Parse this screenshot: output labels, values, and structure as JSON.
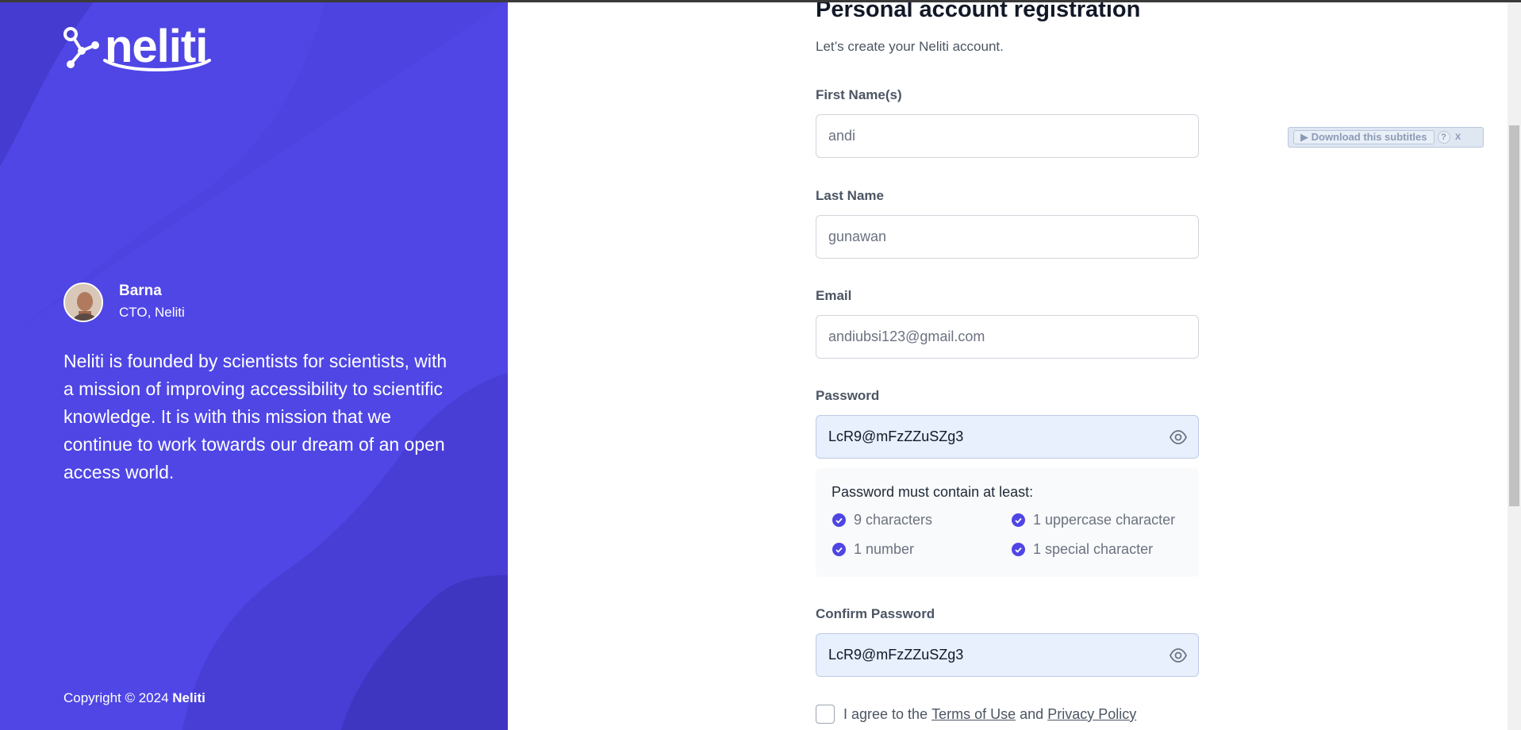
{
  "brand": {
    "name": "neliti",
    "accent_color": "#4f46e5"
  },
  "testimonial": {
    "name": "Barna",
    "role": "CTO, Neliti",
    "quote": "Neliti is founded by scientists for scientists, with a mission of improving accessibility to scientific knowledge. It is with this mission that we continue to work towards our dream of an open access world."
  },
  "footer": {
    "copyright_prefix": "Copyright © 2024",
    "copyright_brand": "Neliti"
  },
  "form": {
    "title": "Personal account registration",
    "subtitle": "Let’s create your Neliti account.",
    "first_name": {
      "label": "First Name(s)",
      "value": "andi"
    },
    "last_name": {
      "label": "Last Name",
      "value": "gunawan"
    },
    "email": {
      "label": "Email",
      "value": "andiubsi123@gmail.com"
    },
    "password": {
      "label": "Password",
      "value": "LcR9@mFzZZuSZg3",
      "icon": "eye-icon"
    },
    "password_requirements": {
      "title": "Password must contain at least:",
      "items": [
        "9 characters",
        "1 uppercase character",
        "1 number",
        "1 special character"
      ]
    },
    "confirm_password": {
      "label": "Confirm Password",
      "value": "LcR9@mFzZZuSZg3",
      "icon": "eye-icon"
    },
    "agree": {
      "prefix": "I agree to the",
      "terms": "Terms of Use",
      "conjunction": "and",
      "privacy": "Privacy Policy"
    }
  },
  "subtitle_plugin": {
    "download_label": "▶ Download this subtitles",
    "help_label": "?",
    "close_label": "X"
  }
}
